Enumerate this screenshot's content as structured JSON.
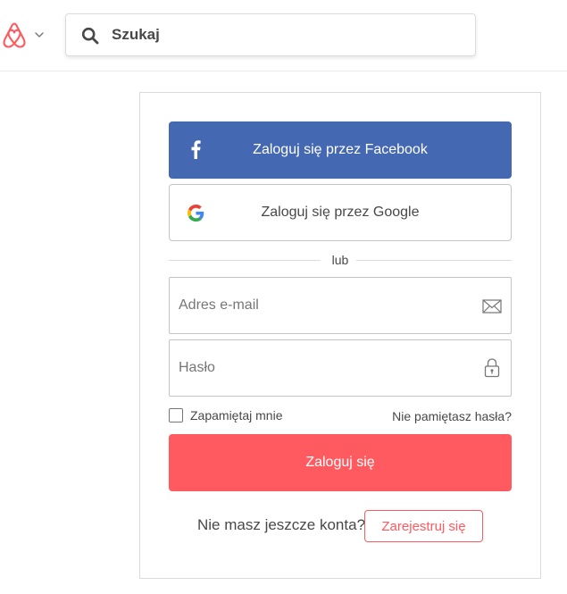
{
  "header": {
    "logo_icon": "airbnb-logo",
    "menu_icon": "chevron-down-icon",
    "search": {
      "placeholder": "Szukaj",
      "icon": "search-icon"
    }
  },
  "login": {
    "facebook_label": "Zaloguj się przez Facebook",
    "google_label": "Zaloguj się przez Google",
    "divider_text": "lub",
    "email_placeholder": "Adres e-mail",
    "password_placeholder": "Hasło",
    "remember_label": "Zapamiętaj mnie",
    "remember_checked": false,
    "forgot_label": "Nie pamiętasz hasła?",
    "submit_label": "Zaloguj się",
    "no_account_text": "Nie masz jeszcze konta?",
    "signup_label": "Zarejestruj się"
  },
  "colors": {
    "brand": "#ff5a5f",
    "facebook": "#4568b2",
    "text": "#484848"
  }
}
